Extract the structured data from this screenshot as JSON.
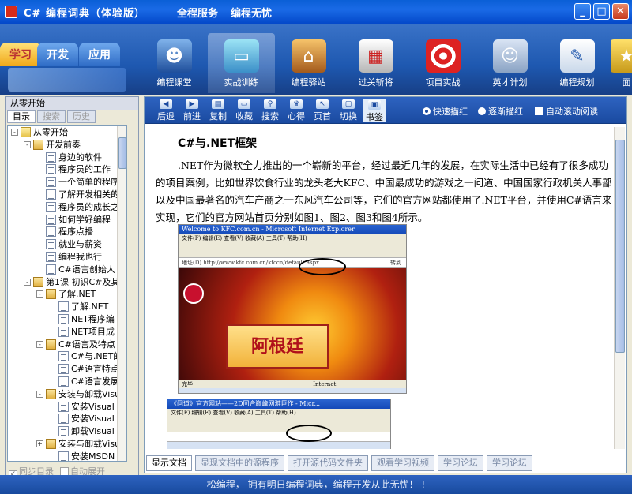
{
  "window": {
    "title": "C#  编程词典（体验版）",
    "menu": [
      "全程服务",
      "编程无忧"
    ],
    "buttons": {
      "minimize": "_",
      "maximize": "□",
      "close": "✕"
    }
  },
  "side_tabs": [
    "学习",
    "开发",
    "应用"
  ],
  "modules": [
    {
      "label": "编程课堂",
      "icon": "teacher-icon"
    },
    {
      "label": "实战训练",
      "icon": "monitor-icon"
    },
    {
      "label": "编程驿站",
      "icon": "house-icon"
    },
    {
      "label": "过关斩将",
      "icon": "gate-icon"
    },
    {
      "label": "项目实战",
      "icon": "target-icon"
    },
    {
      "label": "英才计划",
      "icon": "people-icon"
    },
    {
      "label": "编程规划",
      "icon": "notepad-icon"
    },
    {
      "label": "面",
      "icon": "more-icon"
    }
  ],
  "left_panel": {
    "title": "从零开始",
    "tabs": [
      "目录",
      "搜索",
      "历史"
    ],
    "tree": [
      {
        "label": "从零开始",
        "indent": 0,
        "type": "folder",
        "expand": "-"
      },
      {
        "label": "开发前奏",
        "indent": 1,
        "type": "book",
        "expand": "-"
      },
      {
        "label": "身边的软件",
        "indent": 2,
        "type": "doc"
      },
      {
        "label": "程序员的工作",
        "indent": 2,
        "type": "doc"
      },
      {
        "label": "一个简单的程序",
        "indent": 2,
        "type": "doc"
      },
      {
        "label": "了解开发相关的",
        "indent": 2,
        "type": "doc"
      },
      {
        "label": "程序员的成长之",
        "indent": 2,
        "type": "doc"
      },
      {
        "label": "如何学好编程",
        "indent": 2,
        "type": "doc"
      },
      {
        "label": "程序点播",
        "indent": 2,
        "type": "doc"
      },
      {
        "label": "就业与薪资",
        "indent": 2,
        "type": "doc"
      },
      {
        "label": "编程我也行",
        "indent": 2,
        "type": "doc"
      },
      {
        "label": "C#语言创始人",
        "indent": 2,
        "type": "doc"
      },
      {
        "label": "第1课  初识C#及其",
        "indent": 1,
        "type": "book",
        "expand": "-"
      },
      {
        "label": "了解.NET",
        "indent": 2,
        "type": "book",
        "expand": "-"
      },
      {
        "label": "了解.NET",
        "indent": 3,
        "type": "doc"
      },
      {
        "label": "NET程序编",
        "indent": 3,
        "type": "doc"
      },
      {
        "label": "NET项目成",
        "indent": 3,
        "type": "doc"
      },
      {
        "label": "C#语言及特点",
        "indent": 2,
        "type": "book",
        "expand": "-"
      },
      {
        "label": "C#与.NET的",
        "indent": 3,
        "type": "doc"
      },
      {
        "label": "C#语言特点",
        "indent": 3,
        "type": "doc"
      },
      {
        "label": "C#语言发展",
        "indent": 3,
        "type": "doc"
      },
      {
        "label": "安装与卸载Visu",
        "indent": 2,
        "type": "book",
        "expand": "-"
      },
      {
        "label": "安装Visual S",
        "indent": 3,
        "type": "doc"
      },
      {
        "label": "安装Visual S",
        "indent": 3,
        "type": "doc"
      },
      {
        "label": "卸载Visual S",
        "indent": 3,
        "type": "doc"
      },
      {
        "label": "安装与卸载Visu",
        "indent": 2,
        "type": "book",
        "expand": "+"
      },
      {
        "label": "安装MSDN",
        "indent": 3,
        "type": "doc"
      }
    ],
    "footer": {
      "sync": "同步目录",
      "auto_expand": "自动展开"
    }
  },
  "toolbar": {
    "tools": [
      {
        "label": "后退",
        "glyph": "◀"
      },
      {
        "label": "前进",
        "glyph": "▶"
      },
      {
        "label": "复制",
        "glyph": "▤"
      },
      {
        "label": "收藏",
        "glyph": "▭"
      },
      {
        "label": "搜索",
        "glyph": "⚲"
      },
      {
        "label": "心得",
        "glyph": "♛"
      },
      {
        "label": "页首",
        "glyph": "↖"
      },
      {
        "label": "切换",
        "glyph": "▢"
      },
      {
        "label": "书签",
        "glyph": "▣"
      }
    ],
    "read_modes": [
      "快速描红",
      "逐渐描红"
    ],
    "auto_scroll": "自动滚动阅读"
  },
  "document": {
    "title": "C#与.NET框架",
    "paragraph": ".NET作为微软全力推出的一个崭新的平台，经过最近几年的发展，在实际生活中已经有了很多成功的项目案例，比如世界饮食行业的龙头老大KFC、中国最成功的游戏之一问道、中国国家行政机关人事部以及中国最著名的汽车产商之一东风汽车公司等，它们的官方网站都使用了.NET平台，并使用C#语言来实现，它们的官方网站首页分别如图1、图2、图3和图4所示。",
    "screenshot1": {
      "window_title": "Welcome to KFC.com.cn - Microsoft Internet Explorer",
      "menu": "文件(F)  编辑(E)  查看(V)  收藏(A)  工具(T)  帮助(H)",
      "address": "地址(D)  http://www.kfc.com.cn/kfccn/default.aspx",
      "go": "转到",
      "banner": "阿根廷",
      "status": "完毕",
      "zone": "Internet"
    },
    "screenshot2": {
      "window_title": "《问道》官方网站——2D回合巅峰网游巨作 - Micr...",
      "menu": "文件(F)  编辑(E)  查看(V)  收藏(A)  工具(T)  帮助(H)"
    }
  },
  "bottom_tabs": [
    "显示文档",
    "显现文档中的源程序",
    "打开源代码文件夹",
    "观看学习视频",
    "学习论坛",
    "学习论坛"
  ],
  "status_bar": "松编程，  拥有明日编程词典，编程开发从此无忧！ !"
}
